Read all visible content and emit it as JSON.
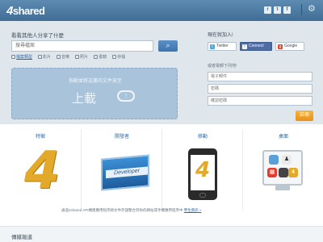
{
  "header": {
    "logo_number": "4",
    "logo_text": "shared",
    "social_icons": [
      {
        "icon": "rss-icon",
        "glyph": "r"
      },
      {
        "icon": "twitter-icon",
        "glyph": "t"
      },
      {
        "icon": "facebook-icon",
        "glyph": "f"
      }
    ],
    "settings_icon": "gear-icon"
  },
  "search": {
    "title": "看看其他人分享了什麼",
    "placeholder": "搜尋檔案",
    "button_icon": "search-icon",
    "filters": [
      {
        "label": "檔案類型",
        "icon": "file-type-icon",
        "active": true
      },
      {
        "label": "影片",
        "icon": "video-icon",
        "active": false
      },
      {
        "label": "音樂",
        "icon": "music-icon",
        "active": false
      },
      {
        "label": "照片",
        "icon": "photo-icon",
        "active": false
      },
      {
        "label": "書籍",
        "icon": "book-icon",
        "active": false
      },
      {
        "label": "存檔",
        "icon": "archive-icon",
        "active": false
      }
    ]
  },
  "upload": {
    "hint": "拖動並將這裏的文件放至",
    "button_label": "上載",
    "icon": "upload-cloud-icon"
  },
  "join": {
    "title": "現在就加入!",
    "twitter_label": "Twitter",
    "facebook_label": "Connect",
    "google_label": "Google",
    "or_email": "或者電郵下列地!",
    "email_placeholder": "電子郵件",
    "password_placeholder": "密碼",
    "confirm_placeholder": "確認密碼",
    "register_label": "註冊"
  },
  "platforms": [
    {
      "label": "特徵",
      "image": "4shared-logo"
    },
    {
      "label": "開發者",
      "image": "developer-box"
    },
    {
      "label": "移動",
      "image": "mobile-phone"
    },
    {
      "label": "桌面",
      "image": "desktop-monitor"
    }
  ],
  "api": {
    "text": "通過4shared API構建應用程序將文件存儲整合到你的網站或手機應用程序中",
    "link": "學生資訊 »"
  },
  "media": {
    "title": "傳媒報道"
  }
}
